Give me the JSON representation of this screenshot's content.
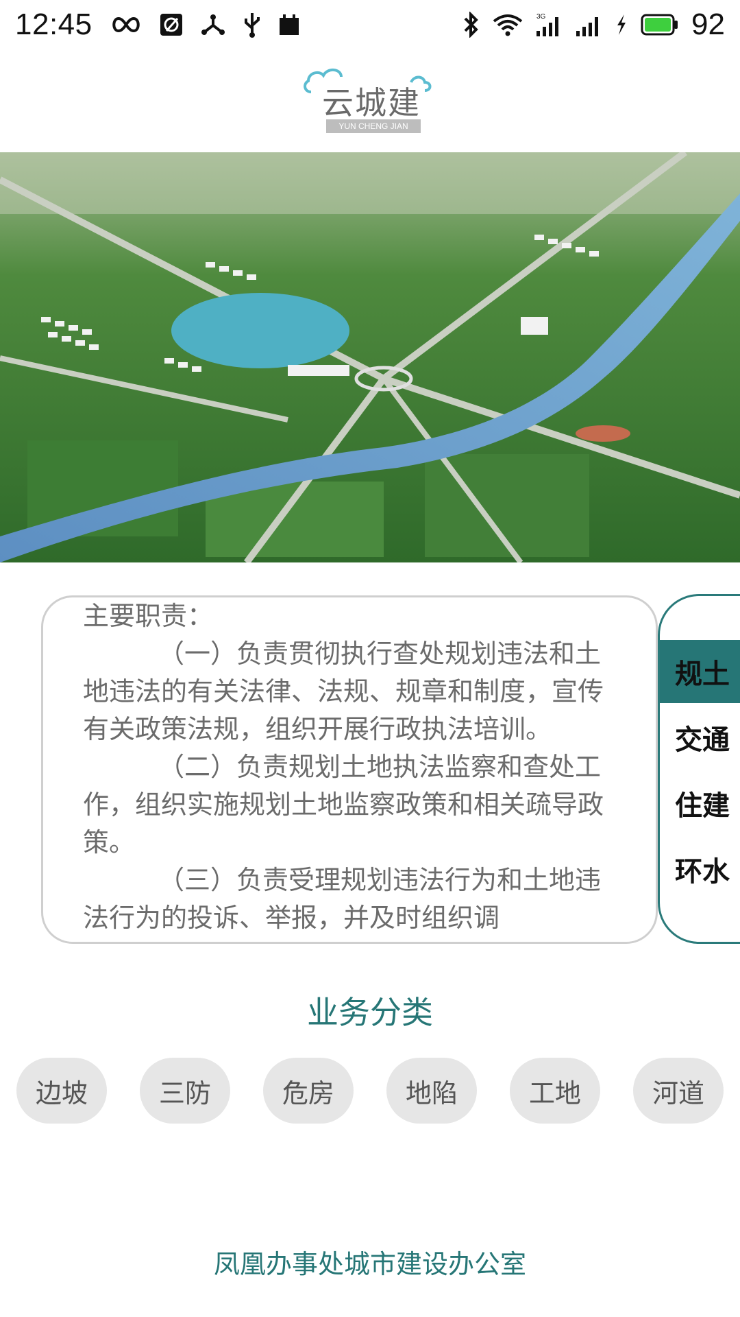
{
  "status_bar": {
    "time": "12:45",
    "battery_level": "92",
    "network_label": "3G",
    "icons_left": [
      "infinity-icon",
      "app-notification-icon",
      "share-node-icon",
      "usb-icon",
      "calendar-icon"
    ],
    "icons_right": [
      "bluetooth-icon",
      "wifi-icon",
      "signal-3g-icon",
      "signal-icon",
      "charging-icon",
      "battery-icon"
    ],
    "battery_color": "#3ecf3e"
  },
  "logo": {
    "text": "云城建",
    "subtext": "YUN CHENG JIAN"
  },
  "banner": {
    "slides_count": 4,
    "active_index": 0
  },
  "duties": {
    "heading": "主要职责：",
    "items": [
      "（一）负责贯彻执行查处规划违法和土地违法的有关法律、法规、规章和制度，宣传有关政策法规，组织开展行政执法培训。",
      "（二）负责规划土地执法监察和查处工作，组织实施规划土地监察政策和相关疏导政策。",
      "（三）负责受理规划违法行为和土地违法行为的投诉、举报，并及时组织调"
    ]
  },
  "side_tabs": {
    "active_index": 0,
    "items": [
      "规土",
      "交通",
      "住建",
      "环水"
    ]
  },
  "categories": {
    "title": "业务分类",
    "items": [
      "边坡",
      "三防",
      "危房",
      "地陷",
      "工地",
      "河道"
    ]
  },
  "footer": {
    "text": "凤凰办事处城市建设办公室"
  },
  "colors": {
    "accent": "#267676",
    "chip_bg": "#e6e6e6",
    "border_gray": "#cfcfcf"
  }
}
